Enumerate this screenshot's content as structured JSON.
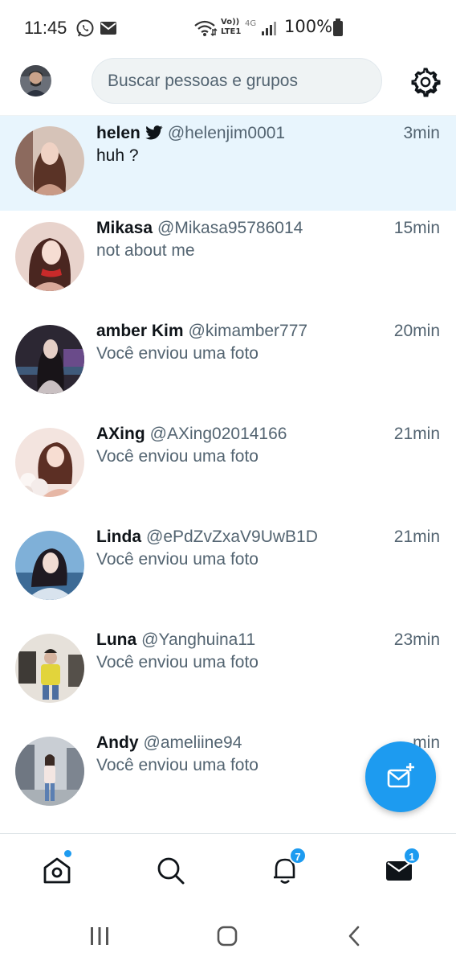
{
  "status_bar": {
    "time": "11:45",
    "volte": "Vo))",
    "lte": "LTE1",
    "network": "4G",
    "battery": "100%"
  },
  "header": {
    "search_placeholder": "Buscar pessoas e grupos",
    "avatar_icon": "user-avatar",
    "settings_icon": "gear-icon"
  },
  "conversations": [
    {
      "name": "helen",
      "handle": "@helenjim0001",
      "time": "3min",
      "message": "huh ?",
      "verified_twitter_icon": true,
      "unread": true,
      "avatar_colors": [
        "#c9a08a",
        "#6b3f33"
      ]
    },
    {
      "name": "Mikasa",
      "handle": "@Mikasa95786014",
      "time": "15min",
      "message": "not about me",
      "avatar_colors": [
        "#e9b8a8",
        "#8a2d2a"
      ]
    },
    {
      "name": "amber Kim",
      "handle": "@kimamber777",
      "time": "20min",
      "message": "Você enviou uma foto",
      "avatar_colors": [
        "#3a3346",
        "#b7a7b3"
      ]
    },
    {
      "name": "AXing",
      "handle": "@AXing02014166",
      "time": "21min",
      "message": "Você enviou uma foto",
      "avatar_colors": [
        "#f1dcd6",
        "#b36e5c"
      ]
    },
    {
      "name": "Linda",
      "handle": "@ePdZvZxaV9UwB1D",
      "time": "21min",
      "message": "Você enviou uma foto",
      "avatar_colors": [
        "#8bb8dd",
        "#2d4b6e"
      ]
    },
    {
      "name": "Luna",
      "handle": "@Yanghuina11",
      "time": "23min",
      "message": "Você enviou uma foto",
      "avatar_colors": [
        "#ddd7cf",
        "#e0d24a"
      ]
    },
    {
      "name": "Andy",
      "handle": "@ameliine94",
      "time": "min",
      "message": "Você enviou uma foto",
      "avatar_colors": [
        "#c3c9cf",
        "#6d7b8c"
      ]
    }
  ],
  "bottom_nav": {
    "notifications_badge": "7",
    "messages_badge": "1"
  },
  "colors": {
    "accent": "#1d9bf0",
    "text_primary": "#0f1419",
    "text_secondary": "#536471",
    "highlight": "#e8f5fd"
  }
}
